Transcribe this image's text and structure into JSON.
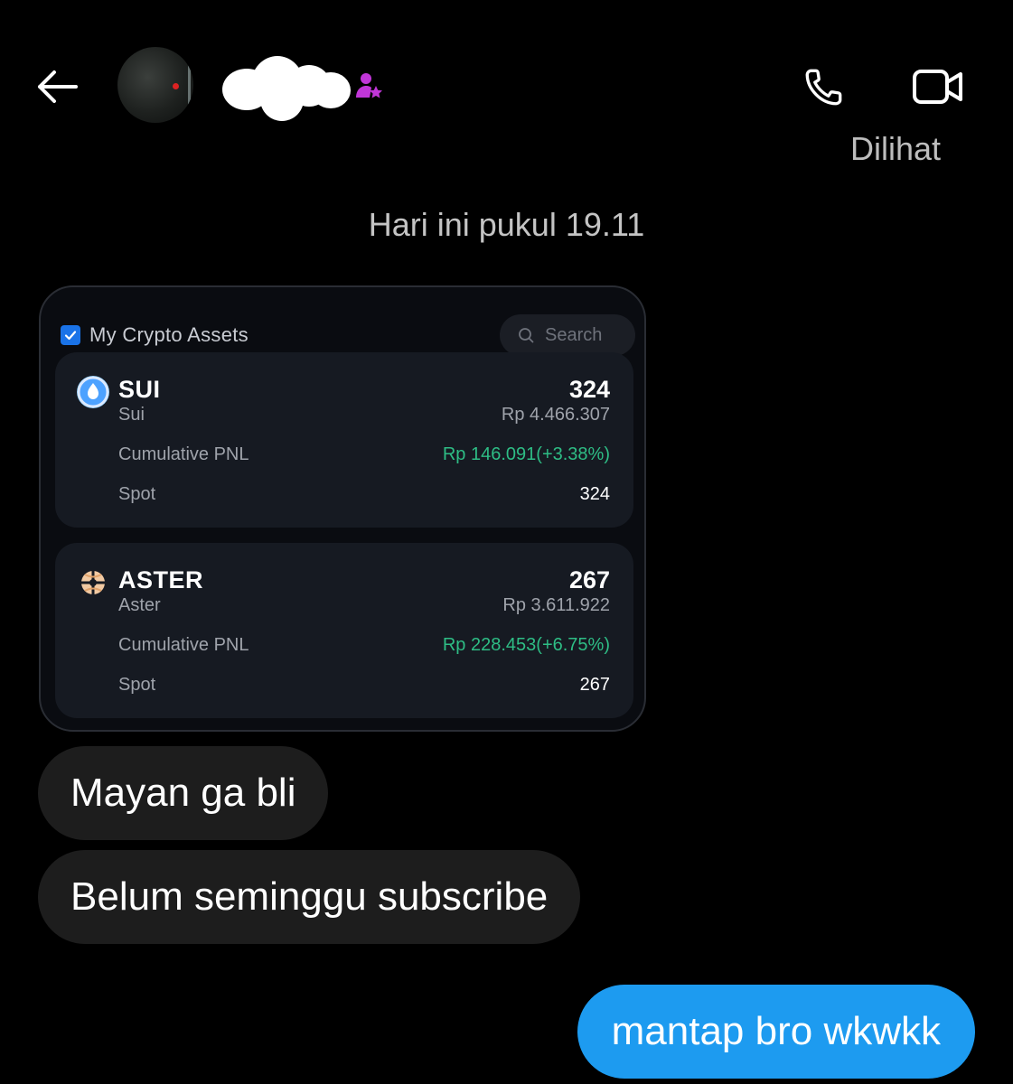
{
  "header": {
    "back_icon": "arrow-left-icon",
    "contact_badge_icon": "person-star-icon",
    "call_icon": "phone-icon",
    "video_icon": "video-camera-icon",
    "status": "Dilihat"
  },
  "conversation": {
    "timestamp": "Hari ini pukul 19.11"
  },
  "shared_image": {
    "title": "My Crypto Assets",
    "search_placeholder": "Search",
    "assets": [
      {
        "symbol": "SUI",
        "name": "Sui",
        "quantity": "324",
        "value": "Rp 4.466.307",
        "pnl_label": "Cumulative PNL",
        "pnl_value": "Rp 146.091(+3.38%)",
        "spot_label": "Spot",
        "spot_value": "324"
      },
      {
        "symbol": "ASTER",
        "name": "Aster",
        "quantity": "267",
        "value": "Rp 3.611.922",
        "pnl_label": "Cumulative PNL",
        "pnl_value": "Rp 228.453(+6.75%)",
        "spot_label": "Spot",
        "spot_value": "267"
      }
    ],
    "pnl_color": "#2ebd85"
  },
  "messages": [
    {
      "direction": "incoming",
      "text": "Mayan ga bli"
    },
    {
      "direction": "incoming",
      "text": "Belum seminggu subscribe"
    },
    {
      "direction": "outgoing",
      "text": "mantap bro wkwkk"
    }
  ],
  "colors": {
    "background": "#000000",
    "incoming_bubble": "#1d1d1d",
    "outgoing_bubble": "#1d9bf0"
  }
}
